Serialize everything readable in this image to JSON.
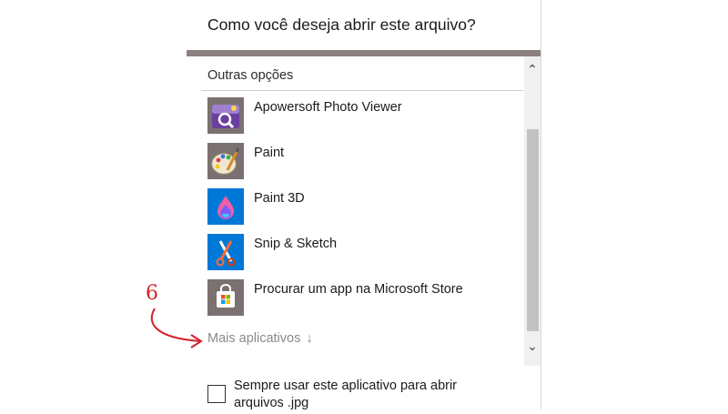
{
  "dialog": {
    "title": "Como você deseja abrir este arquivo?",
    "section_header": "Outras opções",
    "apps": [
      {
        "label": "Apowersoft Photo Viewer",
        "icon": "apowersoft-photo-viewer-icon"
      },
      {
        "label": "Paint",
        "icon": "paint-palette-icon"
      },
      {
        "label": "Paint 3D",
        "icon": "paint-3d-droplet-icon"
      },
      {
        "label": "Snip & Sketch",
        "icon": "snip-sketch-scissors-icon"
      },
      {
        "label": "Procurar um app na Microsoft Store",
        "icon": "microsoft-store-bag-icon"
      }
    ],
    "more_apps": "Mais aplicativos",
    "more_apps_arrow": "↓",
    "checkbox_label": "Sempre usar este aplicativo para abrir arquivos .jpg",
    "checkbox_checked": false
  },
  "scrollbar": {
    "up": "⌃",
    "down": "⌄"
  },
  "annotation": {
    "number": "6",
    "color": "#d2232a"
  },
  "colors": {
    "accent_band": "#8c8080",
    "store_tile": "#7a7170",
    "blue_tile": "#0078d7"
  }
}
